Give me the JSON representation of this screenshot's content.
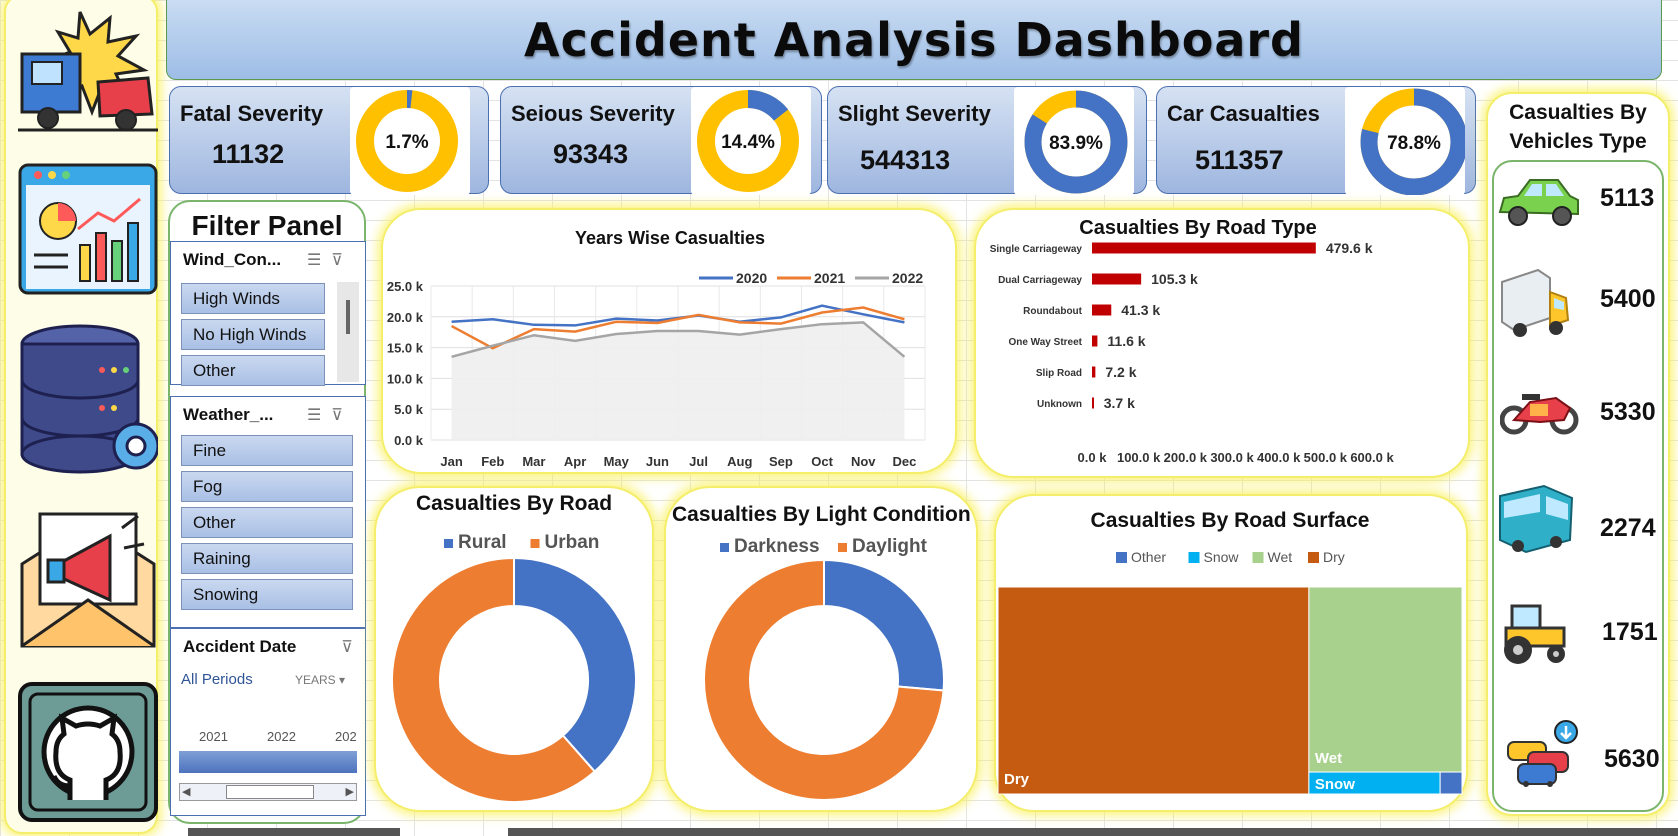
{
  "title": "Accident Analysis Dashboard",
  "kpis": [
    {
      "label": "Fatal Severity",
      "value": "11132",
      "percent": 1.7,
      "percent_label": "1.7%"
    },
    {
      "label": "Seious Severity",
      "value": "93343",
      "percent": 14.4,
      "percent_label": "14.4%"
    },
    {
      "label": "Slight Severity",
      "value": "544313",
      "percent": 83.9,
      "percent_label": "83.9%"
    },
    {
      "label": "Car Casualties",
      "value": "511357",
      "percent": 78.8,
      "percent_label": "78.8%"
    }
  ],
  "colors": {
    "blue": "#4472c4",
    "orange": "#ed7d31",
    "gray": "#a5a5a5",
    "gold": "#ffc000",
    "red": "#c00000",
    "brown": "#c55a11",
    "green": "#a9d18e",
    "cyan": "#00b0f0"
  },
  "filter_panel": {
    "title": "Filter Panel",
    "wind": {
      "header": "Wind_Con...",
      "items": [
        "High Winds",
        "No High Winds",
        "Other"
      ]
    },
    "weather": {
      "header": "Weather_...",
      "items": [
        "Fine",
        "Fog",
        "Other",
        "Raining",
        "Snowing"
      ]
    },
    "date": {
      "header": "Accident Date",
      "period": "All Periods",
      "unit": "YEARS",
      "years": [
        "2021",
        "2022",
        "202"
      ]
    }
  },
  "vehicles": {
    "title": "Casualties By Vehicles Type",
    "items": [
      {
        "icon": "car-icon",
        "value": "5113"
      },
      {
        "icon": "truck-icon",
        "value": "5400"
      },
      {
        "icon": "motorcycle-icon",
        "value": "5330"
      },
      {
        "icon": "bus-icon",
        "value": "2274"
      },
      {
        "icon": "tractor-icon",
        "value": "1751"
      },
      {
        "icon": "traffic-icon",
        "value": "5630"
      }
    ]
  },
  "sidebar": {
    "icons": [
      "crash-icon",
      "dashboard-icon",
      "database-icon",
      "email-megaphone-icon",
      "github-icon"
    ]
  },
  "chart_data": [
    {
      "id": "years",
      "type": "line",
      "title": "Years Wise Casualties",
      "categories": [
        "Jan",
        "Feb",
        "Mar",
        "Apr",
        "May",
        "Jun",
        "Jul",
        "Aug",
        "Sep",
        "Oct",
        "Nov",
        "Dec"
      ],
      "ylim": [
        0,
        25
      ],
      "yticks": [
        "0.0 k",
        "5.0 k",
        "10.0 k",
        "15.0 k",
        "20.0 k",
        "25.0 k"
      ],
      "grid": true,
      "legend": "top-right",
      "series": [
        {
          "name": "2020",
          "values": [
            19.2,
            19.6,
            18.7,
            18.6,
            19.7,
            19.4,
            20.2,
            19.2,
            19.9,
            21.8,
            20.4,
            19.1
          ]
        },
        {
          "name": "2021",
          "values": [
            18.5,
            14.9,
            18.0,
            17.6,
            19.2,
            19.0,
            20.3,
            19.1,
            18.9,
            20.7,
            21.5,
            19.6
          ]
        },
        {
          "name": "2022",
          "values": [
            13.5,
            15.3,
            17.0,
            16.1,
            17.2,
            17.7,
            17.7,
            17.1,
            18.0,
            18.8,
            19.1,
            13.5
          ]
        }
      ]
    },
    {
      "id": "road_type",
      "type": "bar",
      "title": "Casualties By Road Type",
      "categories": [
        "Single Carriageway",
        "Dual Carriageway",
        "Roundabout",
        "One Way Street",
        "Slip Road",
        "Unknown"
      ],
      "values": [
        479.6,
        105.3,
        41.3,
        11.6,
        7.2,
        3.7
      ],
      "labels": [
        "479.6 k",
        "105.3 k",
        "41.3 k",
        "11.6 k",
        "7.2 k",
        "3.7 k"
      ],
      "xlim": [
        0,
        600
      ],
      "xticks": [
        "0.0 k",
        "100.0 k",
        "200.0 k",
        "300.0 k",
        "400.0 k",
        "500.0 k",
        "600.0 k"
      ]
    },
    {
      "id": "road",
      "type": "pie",
      "title": "Casualties By Road",
      "legend": "top",
      "series": [
        {
          "name": "Rural",
          "value": 38.5
        },
        {
          "name": "Urban",
          "value": 61.5
        }
      ]
    },
    {
      "id": "light",
      "type": "pie",
      "title": "Casualties By Light Condition",
      "legend": "top",
      "series": [
        {
          "name": "Darkness",
          "value": 26.4
        },
        {
          "name": "Daylight",
          "value": 73.6
        }
      ]
    },
    {
      "id": "surface",
      "type": "treemap",
      "title": "Casualties By Road Surface",
      "legend": "top",
      "series": [
        {
          "name": "Other",
          "value": 0.5
        },
        {
          "name": "Snow",
          "value": 3.0
        },
        {
          "name": "Wet",
          "value": 29.5
        },
        {
          "name": "Dry",
          "value": 67.0
        }
      ]
    }
  ]
}
